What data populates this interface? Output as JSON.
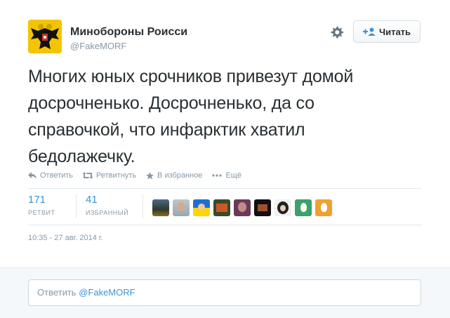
{
  "author": {
    "name": "Минобороны Роисси",
    "handle": "@FakeMORF"
  },
  "follow_label": "Читать",
  "text_lines": [
    "Многих юных срочников привезут домой",
    "досрочненько. Досрочненько, да со",
    "справочкой, что инфарктик хватил",
    "бедолажечку."
  ],
  "actions": {
    "reply": "Ответить",
    "retweet": "Ретвитнуть",
    "favorite": "В избранное",
    "more": "Ещё"
  },
  "stats": {
    "retweets": {
      "count": "171",
      "label": "РЕТВИТ"
    },
    "favorites": {
      "count": "41",
      "label": "ИЗБРАННЫЙ"
    }
  },
  "timestamp": "10:35 - 27 авг. 2014 г.",
  "reply": {
    "prefix": "Ответить",
    "mention": "@FakeMORF"
  },
  "colors": {
    "link": "#3b94d9",
    "muted": "#8899a6",
    "text": "#292f33",
    "avatar_bg": "#f5c400"
  }
}
